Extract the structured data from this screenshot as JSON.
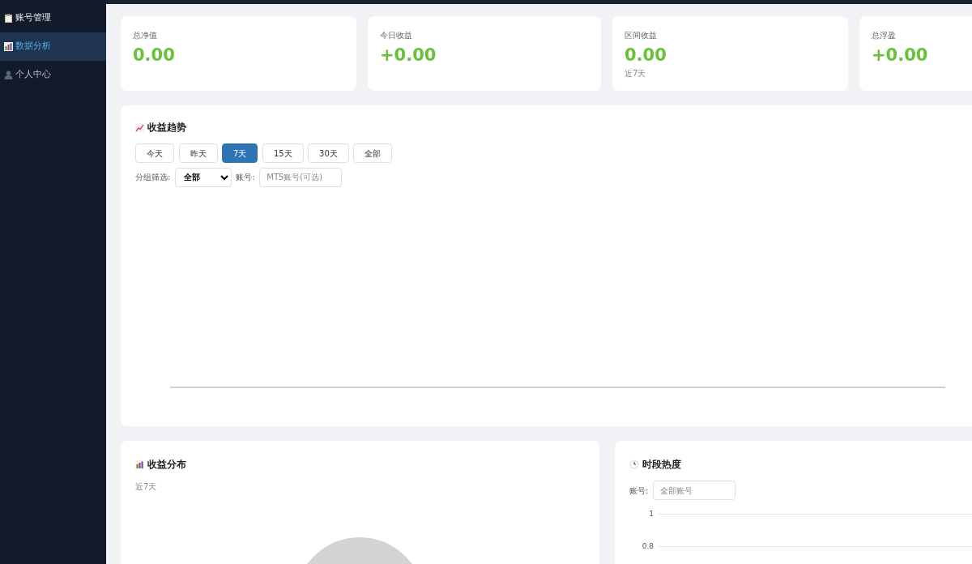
{
  "sidebar": {
    "items": [
      {
        "label": "账号管理",
        "selected": false,
        "bold": true
      },
      {
        "label": "数据分析",
        "selected": true,
        "bold": false
      },
      {
        "label": "个人中心",
        "selected": false,
        "bold": false
      }
    ]
  },
  "stats": [
    {
      "label": "总净值",
      "value": "0.00"
    },
    {
      "label": "今日收益",
      "value": "+0.00"
    },
    {
      "label": "区间收益",
      "value": "0.00",
      "note": "近7天"
    },
    {
      "label": "总浮盈",
      "value": "+0.00"
    }
  ],
  "trend": {
    "title": "收益趋势",
    "ranges": [
      {
        "label": "今天",
        "selected": false
      },
      {
        "label": "昨天",
        "selected": false
      },
      {
        "label": "7天",
        "selected": true
      },
      {
        "label": "15天",
        "selected": false
      },
      {
        "label": "30天",
        "selected": false
      },
      {
        "label": "全部",
        "selected": false
      }
    ],
    "group_label": "分组筛选:",
    "group_value": "全部",
    "account_label": "账号:",
    "account_placeholder": "MT5账号(可选)"
  },
  "distribution": {
    "title": "收益分布",
    "subtitle": "近7天"
  },
  "heat": {
    "title": "时段热度",
    "account_label": "账号:",
    "account_placeholder": "全部账号",
    "axis_labels": [
      "1",
      "0.8"
    ]
  }
}
